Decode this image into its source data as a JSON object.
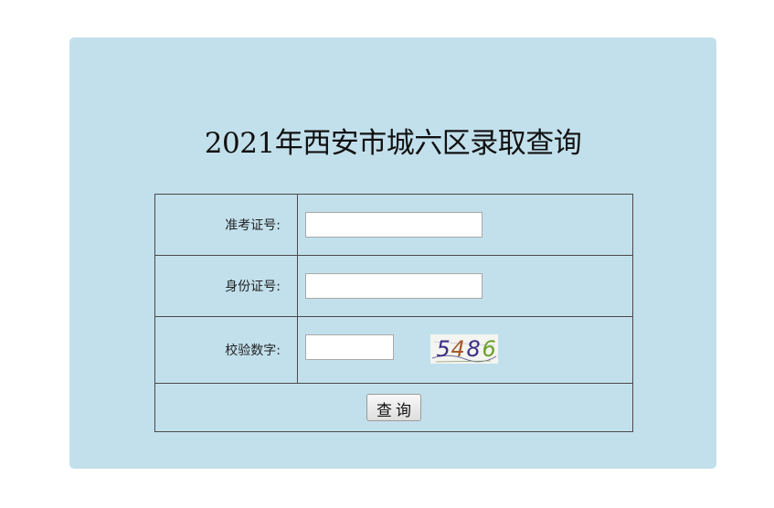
{
  "page": {
    "title": "2021年西安市城六区录取查询"
  },
  "form": {
    "exam_number_label": "准考证号:",
    "exam_number_value": "",
    "id_number_label": "身份证号:",
    "id_number_value": "",
    "captcha_label": "校验数字:",
    "captcha_value": "",
    "captcha_image_text": "5486",
    "captcha_digit_1": "5",
    "captcha_digit_2": "4",
    "captcha_digit_3": "8",
    "captcha_digit_4": "6",
    "submit_label": "查询"
  },
  "colors": {
    "panel_background": "#c2e0ec",
    "border": "#4a4a4a",
    "captcha_digit_colors": [
      "#3b2f86",
      "#a55a2a",
      "#3b2f86",
      "#6aa02a"
    ]
  }
}
